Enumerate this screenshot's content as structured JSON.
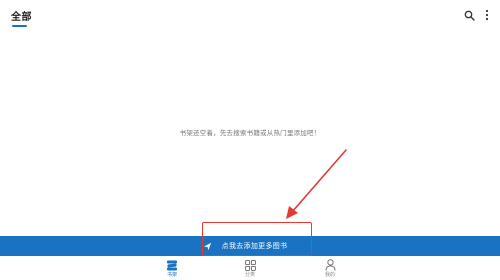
{
  "header": {
    "tab_all_label": "全部"
  },
  "empty_state": {
    "message": "书架还空着，先去搜索书籍或从热门里添加吧！"
  },
  "action_bar": {
    "label": "点我去添加更多图书",
    "icon": "paper-plane-icon"
  },
  "bottom_nav": {
    "items": [
      {
        "label": "书架",
        "icon": "bookshelf-icon",
        "active": true
      },
      {
        "label": "分类",
        "icon": "grid-icon",
        "active": false
      },
      {
        "label": "我的",
        "icon": "person-icon",
        "active": false
      }
    ]
  },
  "colors": {
    "accent": "#1a72c2",
    "annotation": "#e53935",
    "muted_text": "#777777"
  }
}
